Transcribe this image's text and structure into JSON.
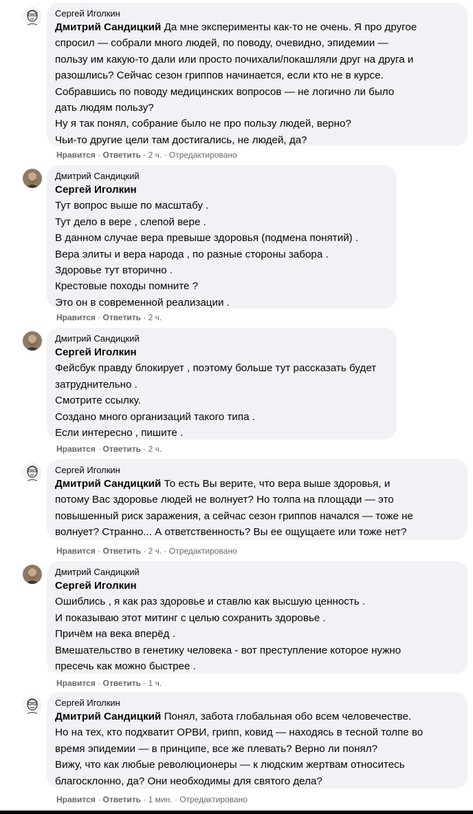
{
  "colors": {
    "bubble_bg": "#f0f2f5",
    "text": "#050505",
    "meta_text": "#65676b"
  },
  "comments": [
    {
      "author": "Сергей Иголкин",
      "avatar": "sketch-face",
      "mention": "Дмитрий Сандицкий",
      "lines": [
        "Да мне эксперименты как-то не очень. Я про другое",
        "спросил — собрали много людей, по поводу, очевидно, эпидемии —",
        "пользу им какую-то дали или просто почихали/покашляли друг на друга и",
        "разошлись? Сейчас сезон гриппов начинается, если кто не в курсе.",
        "Собравшись по поводу медицинских вопросов — не логично ли было",
        "дать людям пользу?",
        "Ну я так понял, собрание было не про пользу людей, верно?",
        "Чьи-то другие цели там достигались, не людей, да?"
      ],
      "like_label": "Нравится",
      "reply_label": "Ответить",
      "time": "2 ч.",
      "edited": "Отредактировано"
    },
    {
      "author": "Дмитрий Сандицкий",
      "avatar": "bearded-man",
      "mention": "Сергей Иголкин",
      "lines": [
        "Тут вопрос выше по масштабу .",
        "Тут дело в вере , слепой вере .",
        "В данном случае вера превыше здоровья (подмена понятий) .",
        "Вера элиты и вера народа , по разные стороны забора .",
        "Здоровье тут вторично .",
        "Крестовые походы помните ?",
        "Это он в современной реализации ."
      ],
      "like_label": "Нравится",
      "reply_label": "Ответить",
      "time": "2 ч.",
      "edited": ""
    },
    {
      "author": "Дмитрий Сандицкий",
      "avatar": "bearded-man",
      "mention": "Сергей Иголкин",
      "lines": [
        "Фейсбук правду блокирует , поэтому больше тут рассказать будет",
        "затруднительно .",
        "Смотрите ссылку.",
        "Создано много организаций такого типа .",
        "Если интересно , пишите ."
      ],
      "like_label": "Нравится",
      "reply_label": "Ответить",
      "time": "2 ч.",
      "edited": ""
    },
    {
      "author": "Сергей Иголкин",
      "avatar": "sketch-face",
      "mention": "Дмитрий Сандицкий",
      "lines": [
        "То есть Вы верите, что вера выше здоровья, и",
        "потому Вас здоровье людей не волнует? Но толпа на площади — это",
        "повышенный риск заражения, а сейчас сезон гриппов начался — тоже не",
        "волнует? Странно... А ответственность? Вы ее ощущаете или тоже нет?"
      ],
      "like_label": "Нравится",
      "reply_label": "Ответить",
      "time": "2 ч.",
      "edited": "Отредактировано"
    },
    {
      "author": "Дмитрий Сандицкий",
      "avatar": "bearded-man",
      "mention": "Сергей Иголкин",
      "lines": [
        "Ошиблись , я как раз здоровье и ставлю как высшую ценность .",
        "И показываю этот митинг с целью сохранить здоровье .",
        "Причём на века вперёд .",
        "Вмешательство в генетику человека - вот преступление которое нужно",
        "пресечь как можно быстрее ."
      ],
      "like_label": "Нравится",
      "reply_label": "Ответить",
      "time": "1 ч.",
      "edited": ""
    },
    {
      "author": "Сергей Иголкин",
      "avatar": "sketch-face",
      "mention": "Дмитрий Сандицкий",
      "lines": [
        "Понял, забота глобальная обо всем человечестве.",
        "Но на тех, кто подхватит ОРВИ, грипп, ковид — находясь в тесной толпе во",
        "время эпидемии — в принципе, все же плевать? Верно ли понял?",
        "Вижу, что как любые революционеры — к людским жертвам относитесь",
        "благосклонно, да? Они необходимы для святого дела?"
      ],
      "like_label": "Нравится",
      "reply_label": "Ответить",
      "time": "1 мин.",
      "edited": "Отредактировано"
    }
  ]
}
